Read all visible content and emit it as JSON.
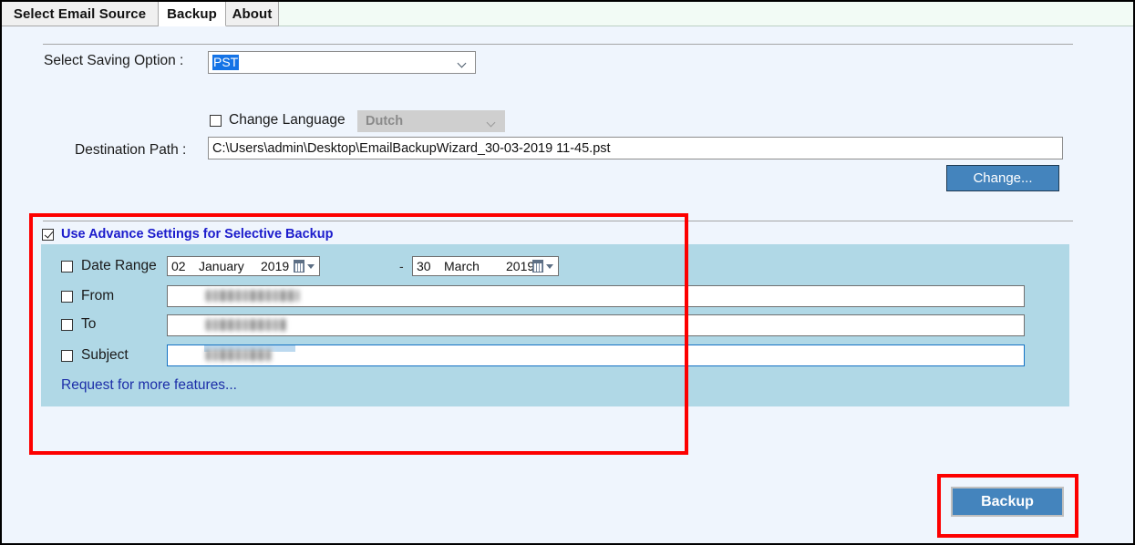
{
  "window": {
    "tabs": [
      {
        "id": "select-email-source",
        "label": "Select Email Source",
        "active": false
      },
      {
        "id": "backup",
        "label": "Backup",
        "active": true
      },
      {
        "id": "about",
        "label": "About",
        "active": false
      }
    ]
  },
  "form": {
    "saving_option_label": "Select Saving Option :",
    "saving_option_value": "PST",
    "change_language_label": "Change Language",
    "language_value": "Dutch",
    "destination_path_label": "Destination Path :",
    "destination_path_value": "C:\\Users\\admin\\Desktop\\EmailBackupWizard_30-03-2019 11-45.pst",
    "change_button_label": "Change..."
  },
  "advance": {
    "header_label": "Use Advance Settings for Selective Backup",
    "date_range_label": "Date Range",
    "date_separator": "-",
    "date_from": {
      "day": "02",
      "month": "January",
      "year": "2019"
    },
    "date_to": {
      "day": "30",
      "month": "March",
      "year": "2019"
    },
    "from_label": "From",
    "to_label": "To",
    "subject_label": "Subject",
    "from_value": "",
    "to_value": "",
    "subject_value": "",
    "request_features_label": "Request for more features..."
  },
  "actions": {
    "backup_button_label": "Backup"
  },
  "colors": {
    "page_background": "#eff5fd",
    "panel_background": "#b0d8e6",
    "button_blue": "#4484bd",
    "annotation_red": "#fd0000",
    "link_blue": "#1c2ea8",
    "header_label_blue": "#1c1ccc",
    "selection_blue": "#1473e6"
  }
}
